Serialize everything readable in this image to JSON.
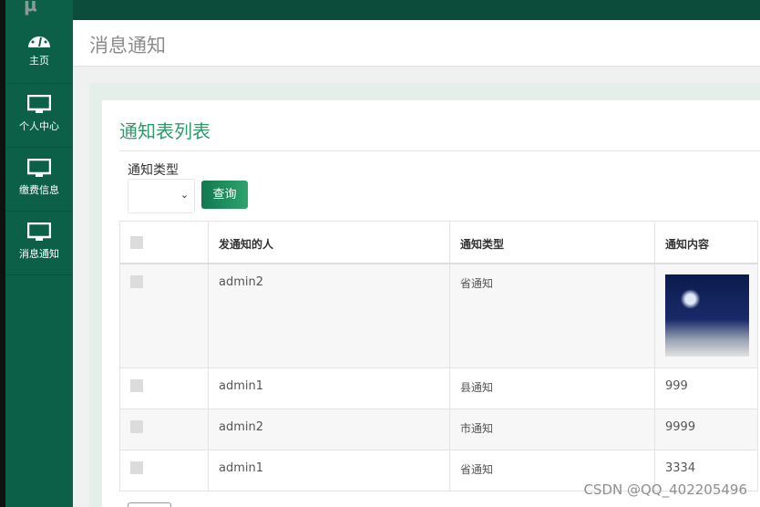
{
  "sidebar": {
    "logo": "μ",
    "items": [
      {
        "label": "主页",
        "icon": "dashboard-icon"
      },
      {
        "label": "个人中心",
        "icon": "monitor-icon"
      },
      {
        "label": "缴费信息",
        "icon": "monitor-icon"
      },
      {
        "label": "消息通知",
        "icon": "monitor-icon"
      }
    ]
  },
  "header": {
    "title": "消息通知"
  },
  "card": {
    "title": "通知表列表",
    "filter_label": "通知类型",
    "select_value": "",
    "query_label": "查询"
  },
  "table": {
    "columns": [
      "发通知的人",
      "通知类型",
      "通知内容"
    ],
    "rows": [
      {
        "sender": "admin2",
        "type": "省通知",
        "content": ""
      },
      {
        "sender": "admin1",
        "type": "县通知",
        "content": "999"
      },
      {
        "sender": "admin2",
        "type": "市通知",
        "content": "9999"
      },
      {
        "sender": "admin1",
        "type": "省通知",
        "content": "3334"
      }
    ]
  },
  "watermark": "CSDN @QQ_402205496"
}
